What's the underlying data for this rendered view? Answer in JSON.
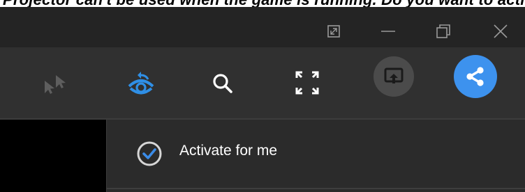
{
  "top_strip": {
    "text": "Projector can't be used when the game is running. Do you want to activate it?"
  },
  "window_controls": {
    "icons": [
      "restore-small-icon",
      "minimize-icon",
      "maximize-restore-icon",
      "close-icon"
    ]
  },
  "toolbar": {
    "tools": [
      {
        "icon": "multi-cursor-icon",
        "state": "disabled"
      },
      {
        "icon": "eye-sync-icon",
        "state": "active",
        "color": "#2f8fe6"
      },
      {
        "icon": "search-icon",
        "state": "normal"
      },
      {
        "icon": "fullscreen-icon",
        "state": "normal"
      },
      {
        "icon": "screen-share-icon",
        "state": "disabled"
      },
      {
        "icon": "share-icon",
        "state": "highlighted",
        "color": "#3d92ee"
      }
    ]
  },
  "activate_row": {
    "label": "Activate for me",
    "checked": true,
    "check_color": "#3b8ce8"
  }
}
